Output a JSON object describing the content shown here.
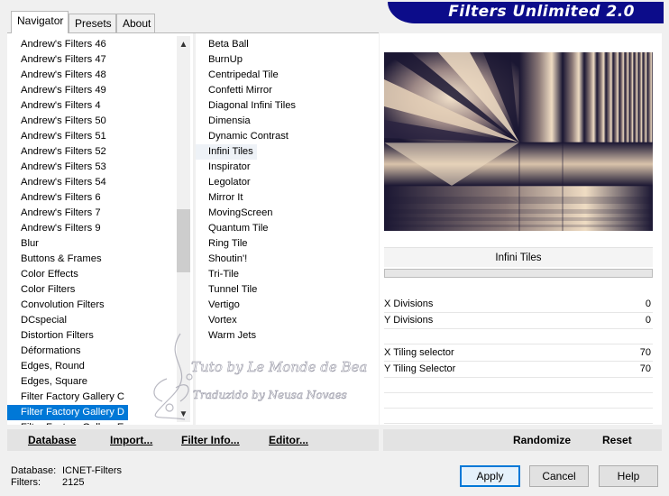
{
  "tabs": [
    {
      "label": "Navigator",
      "active": true
    },
    {
      "label": "Presets",
      "active": false
    },
    {
      "label": "About",
      "active": false
    }
  ],
  "banner_title": "Filters Unlimited 2.0",
  "categories": [
    "Andrew's Filters 46",
    "Andrew's Filters 47",
    "Andrew's Filters 48",
    "Andrew's Filters 49",
    "Andrew's Filters 4",
    "Andrew's Filters 50",
    "Andrew's Filters 51",
    "Andrew's Filters 52",
    "Andrew's Filters 53",
    "Andrew's Filters 54",
    "Andrew's Filters 6",
    "Andrew's Filters 7",
    "Andrew's Filters 9",
    "Blur",
    "Buttons & Frames",
    "Color Effects",
    "Color Filters",
    "Convolution Filters",
    "DCspecial",
    "Distortion Filters",
    "Déformations",
    "Edges, Round",
    "Edges, Square",
    "Filter Factory Gallery C",
    "Filter Factory Gallery D",
    "Filter Factory Gallery E"
  ],
  "selected_category": "Filter Factory Gallery D",
  "filters": [
    "Beta Ball",
    "BurnUp",
    "Centripedal Tile",
    "Confetti Mirror",
    "Diagonal Infini Tiles",
    "Dimensia",
    "Dynamic Contrast",
    "Infini Tiles",
    "Inspirator",
    "Legolator",
    "Mirror It",
    "MovingScreen",
    "Quantum Tile",
    "Ring Tile",
    "Shoutin'!",
    "Tri-Tile",
    "Tunnel Tile",
    "Vertigo",
    "Vortex",
    "Warm Jets"
  ],
  "selected_filter": "Infini Tiles",
  "filter_title": "Infini Tiles",
  "params": [
    {
      "label": "X Divisions",
      "value": "0"
    },
    {
      "label": "Y Divisions",
      "value": "0"
    },
    {
      "label": "X Tiling selector",
      "value": "70"
    },
    {
      "label": "Y Tiling Selector",
      "value": "70"
    }
  ],
  "bottom_buttons": {
    "database": "Database",
    "import": "Import...",
    "filter_info": "Filter Info...",
    "editor": "Editor...",
    "randomize": "Randomize",
    "reset": "Reset"
  },
  "status": {
    "database_label": "Database:",
    "database_value": "ICNET-Filters",
    "filters_label": "Filters:",
    "filters_value": "2125"
  },
  "dialog_buttons": {
    "apply": "Apply",
    "cancel": "Cancel",
    "help": "Help"
  },
  "watermark": {
    "line1": "Tuto by Le Monde de Bea",
    "line2": "Traduzido by Neusa Novaes"
  },
  "colors": {
    "accent": "#0078d7",
    "banner": "#0c0c8a",
    "preview_dark": "#1b1733",
    "preview_light": "#efdcc3"
  }
}
